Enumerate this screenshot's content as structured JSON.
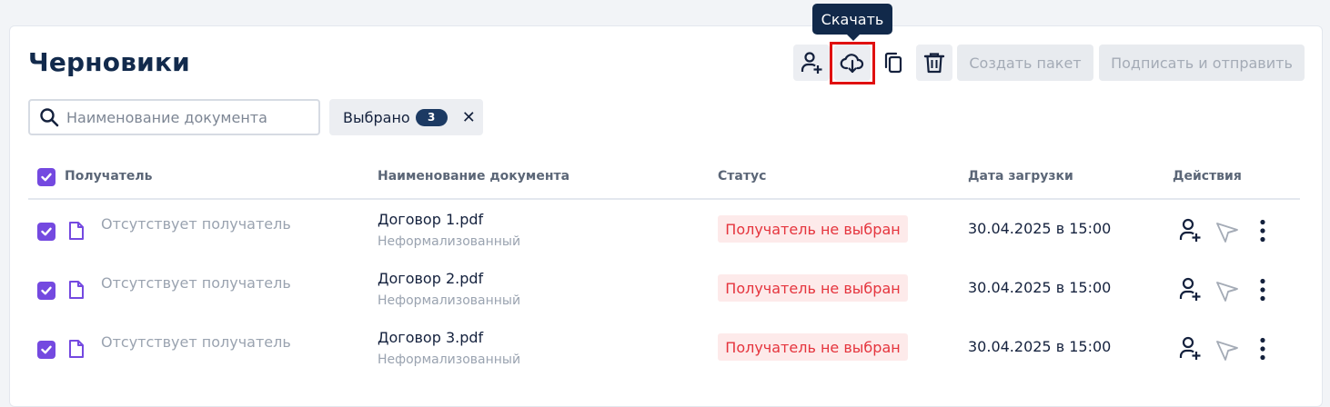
{
  "page": {
    "title": "Черновики"
  },
  "tooltip": {
    "text": "Скачать"
  },
  "toolbar": {
    "icons": [
      "add-recipient-icon",
      "cloud-download-icon",
      "copy-icon",
      "trash-icon"
    ],
    "create_package_label": "Создать пакет",
    "sign_send_label": "Подписать и отправить"
  },
  "search": {
    "value": "",
    "placeholder": "Наименование документа"
  },
  "selection": {
    "label": "Выбрано",
    "count": "3",
    "clear_icon": "close-icon"
  },
  "table": {
    "headers": {
      "recipient": "Получатель",
      "doc_name": "Наименование документа",
      "status": "Статус",
      "date": "Дата загрузки",
      "actions": "Действия"
    },
    "header_checkbox_checked": true,
    "rows": [
      {
        "checked": true,
        "recipient": "Отсутствует получатель",
        "doc_name": "Договор 1.pdf",
        "doc_type": "Неформализованный",
        "status": "Получатель не выбран",
        "date": "30.04.2025 в 15:00"
      },
      {
        "checked": true,
        "recipient": "Отсутствует получатель",
        "doc_name": "Договор 2.pdf",
        "doc_type": "Неформализованный",
        "status": "Получатель не выбран",
        "date": "30.04.2025 в 15:00"
      },
      {
        "checked": true,
        "recipient": "Отсутствует получатель",
        "doc_name": "Договор 3.pdf",
        "doc_type": "Неформализованный",
        "status": "Получатель не выбран",
        "date": "30.04.2025 в 15:00"
      }
    ]
  },
  "colors": {
    "accent_checkbox": "#7449e0",
    "title": "#122a4c",
    "status_text": "#e5343d",
    "status_bg": "#fdeaea",
    "tooltip_bg": "#11294a",
    "highlight": "#e01010"
  }
}
